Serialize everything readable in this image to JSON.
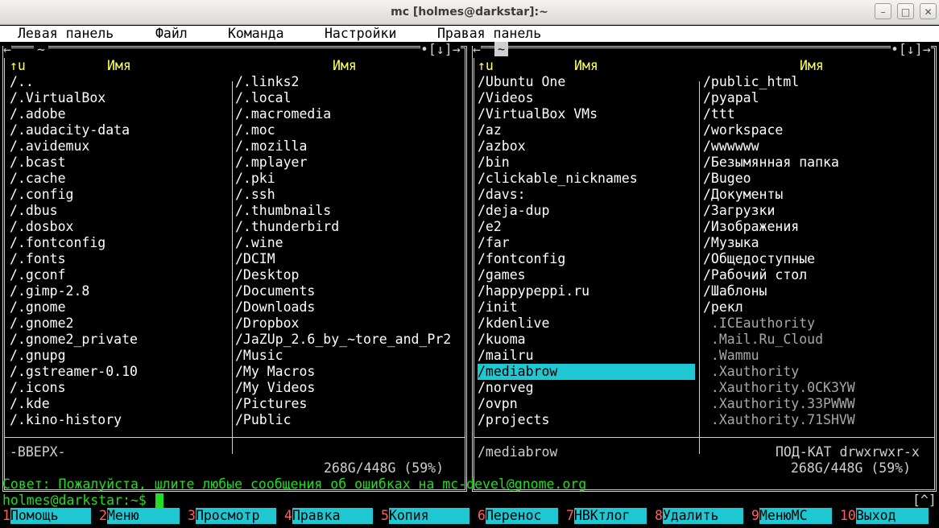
{
  "window": {
    "title": "mc [holmes@darkstar]:~"
  },
  "menu": [
    "Левая панель",
    "Файл",
    "Команда",
    "Настройки",
    "Правая панель"
  ],
  "panel_frame": {
    "left_path": "~",
    "right_path": "~",
    "corner_controls": "•[↓]→",
    "corner_left": "←"
  },
  "left_panel": {
    "sort_indicator": "↑u",
    "col_header": "Имя",
    "col1": [
      "/..",
      "/.VirtualBox",
      "/.adobe",
      "/.audacity-data",
      "/.avidemux",
      "/.bcast",
      "/.cache",
      "/.config",
      "/.dbus",
      "/.dosbox",
      "/.fontconfig",
      "/.fonts",
      "/.gconf",
      "/.gimp-2.8",
      "/.gnome",
      "/.gnome2",
      "/.gnome2_private",
      "/.gnupg",
      "/.gstreamer-0.10",
      "/.icons",
      "/.kde",
      "/.kino-history"
    ],
    "col2": [
      "/.links2",
      "/.local",
      "/.macromedia",
      "/.moc",
      "/.mozilla",
      "/.mplayer",
      "/.pki",
      "/.ssh",
      "/.thumbnails",
      "/.thunderbird",
      "/.wine",
      "/DCIM",
      "/Desktop",
      "/Documents",
      "/Downloads",
      "/Dropbox",
      "/JaZUp_2.6_by_~tore_and_Pr2",
      "/Music",
      "/My Macros",
      "/My Videos",
      "/Pictures",
      "/Public"
    ],
    "status": "-ВВЕРХ-",
    "disk": "268G/448G (59%)"
  },
  "right_panel": {
    "sort_indicator": "↑u",
    "col_header": "Имя",
    "col1": [
      "/Ubuntu One",
      "/Videos",
      "/VirtualBox VMs",
      "/az",
      "/azbox",
      "/bin",
      "/clickable_nicknames",
      "/davs:",
      "/deja-dup",
      "/e2",
      "/far",
      "/fontconfig",
      "/games",
      "/happypeppi.ru",
      "/init",
      "/kdenlive",
      "/kuoma",
      "/mailru",
      "/mediabrow",
      "/norveg",
      "/ovpn",
      "/projects"
    ],
    "col2": [
      "/public_html",
      "/pyapal",
      "/ttt",
      "/workspace",
      "/wwwwww",
      "/Безымянная папка",
      "/Bugeo",
      "/Документы",
      "/Загрузки",
      "/Изображения",
      "/Музыка",
      "/Общедоступные",
      "/Рабочий стол",
      "/Шаблоны",
      "/рекл",
      " .ICEauthority",
      " .Mail.Ru_Cloud",
      " .Wammu",
      " .Xauthority",
      " .Xauthority.0CK3YW",
      " .Xauthority.33PWWW",
      " .Xauthority.71SHVW"
    ],
    "col2_hidden_from": 15,
    "selected_index": 18,
    "status_name": "/mediabrow",
    "status_info": "ПОД-КАТ drwxrwxr-x",
    "disk": "268G/448G (59%)"
  },
  "hint": "Совет: Пожалуйста, шлите любые сообщения об ошибках на mc-devel@gnome.org",
  "prompt": "holmes@darkstar:~$",
  "prompt_right": "[^]",
  "fkeys": [
    {
      "num": "1",
      "label": "Помощь"
    },
    {
      "num": "2",
      "label": "Меню"
    },
    {
      "num": "3",
      "label": "Просмотр"
    },
    {
      "num": "4",
      "label": "Правка"
    },
    {
      "num": "5",
      "label": "Копия"
    },
    {
      "num": "6",
      "label": "Перенос"
    },
    {
      "num": "7",
      "label": "НВКтлог"
    },
    {
      "num": "8",
      "label": "Удалить"
    },
    {
      "num": "9",
      "label": "МенюМС"
    },
    {
      "num": "10",
      "label": "Выход"
    }
  ],
  "colors": {
    "header": "#ffff55",
    "selection": "#1ec8d2",
    "hint": "#22dd22",
    "fkey_num": "#ff6060"
  }
}
